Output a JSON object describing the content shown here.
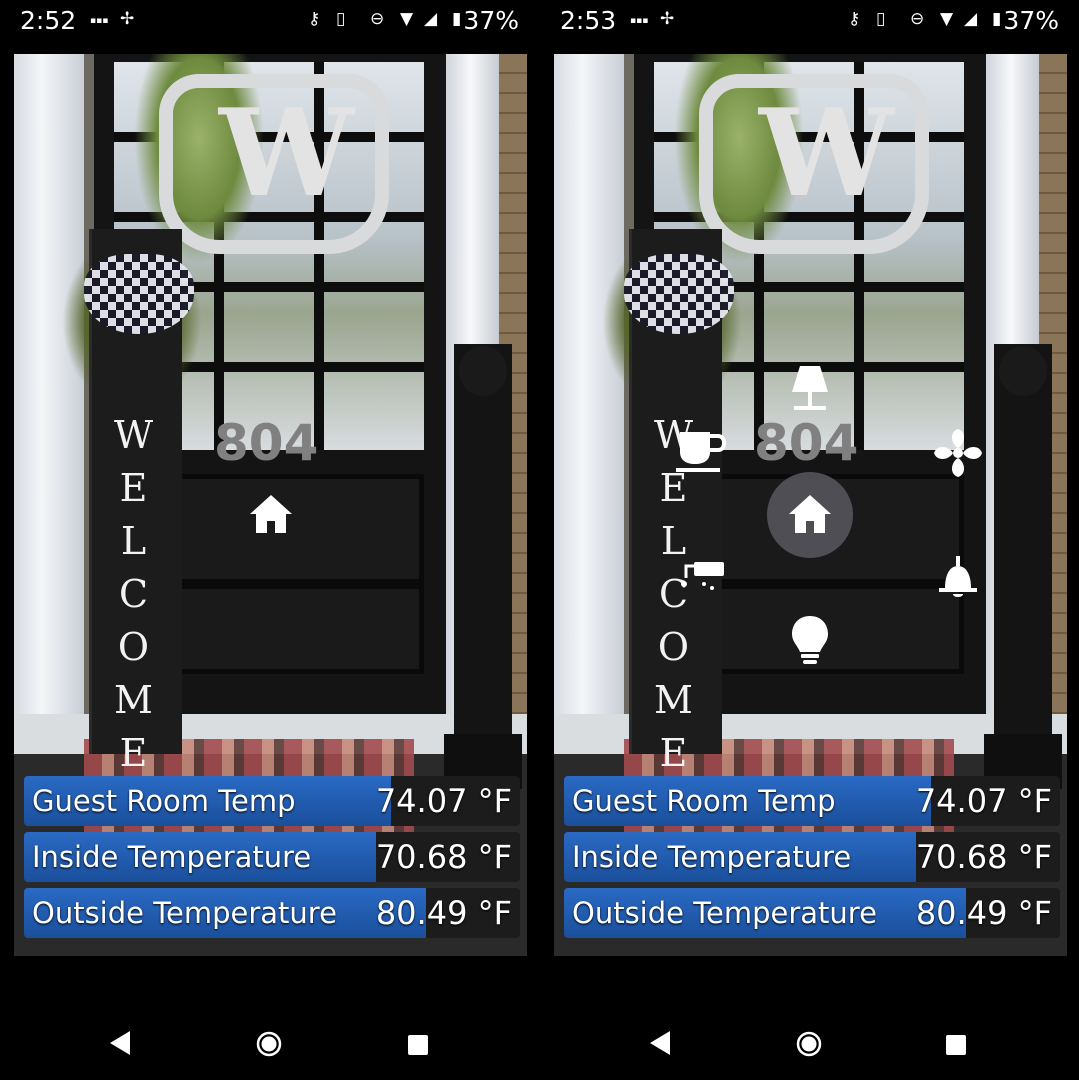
{
  "left": {
    "status": {
      "time": "2:52",
      "battery": "37%"
    },
    "house_number": "804",
    "welcome_letters": [
      "W",
      "E",
      "L",
      "C",
      "O",
      "M",
      "E"
    ],
    "rows": [
      {
        "label": "Guest Room Temp",
        "value": "74.07 °F",
        "fill": 0.74
      },
      {
        "label": "Inside Temperature",
        "value": "70.68 °F",
        "fill": 0.71
      },
      {
        "label": "Outside Temperature",
        "value": "80.49 °F",
        "fill": 0.81
      }
    ]
  },
  "right": {
    "status": {
      "time": "2:53",
      "battery": "37%"
    },
    "house_number": "804",
    "welcome_letters": [
      "W",
      "E",
      "L",
      "C",
      "O",
      "M",
      "E"
    ],
    "menu_items": [
      "lamp-icon",
      "coffee-cup-icon",
      "fan-icon",
      "heater-icon",
      "bell-icon",
      "light-bulb-icon"
    ],
    "rows": [
      {
        "label": "Guest Room Temp",
        "value": "74.07 °F",
        "fill": 0.74
      },
      {
        "label": "Inside Temperature",
        "value": "70.68 °F",
        "fill": 0.71
      },
      {
        "label": "Outside Temperature",
        "value": "80.49 °F",
        "fill": 0.81
      }
    ]
  },
  "colors": {
    "bar_fill": "#2a6ac4",
    "hub": "#5a5860"
  }
}
